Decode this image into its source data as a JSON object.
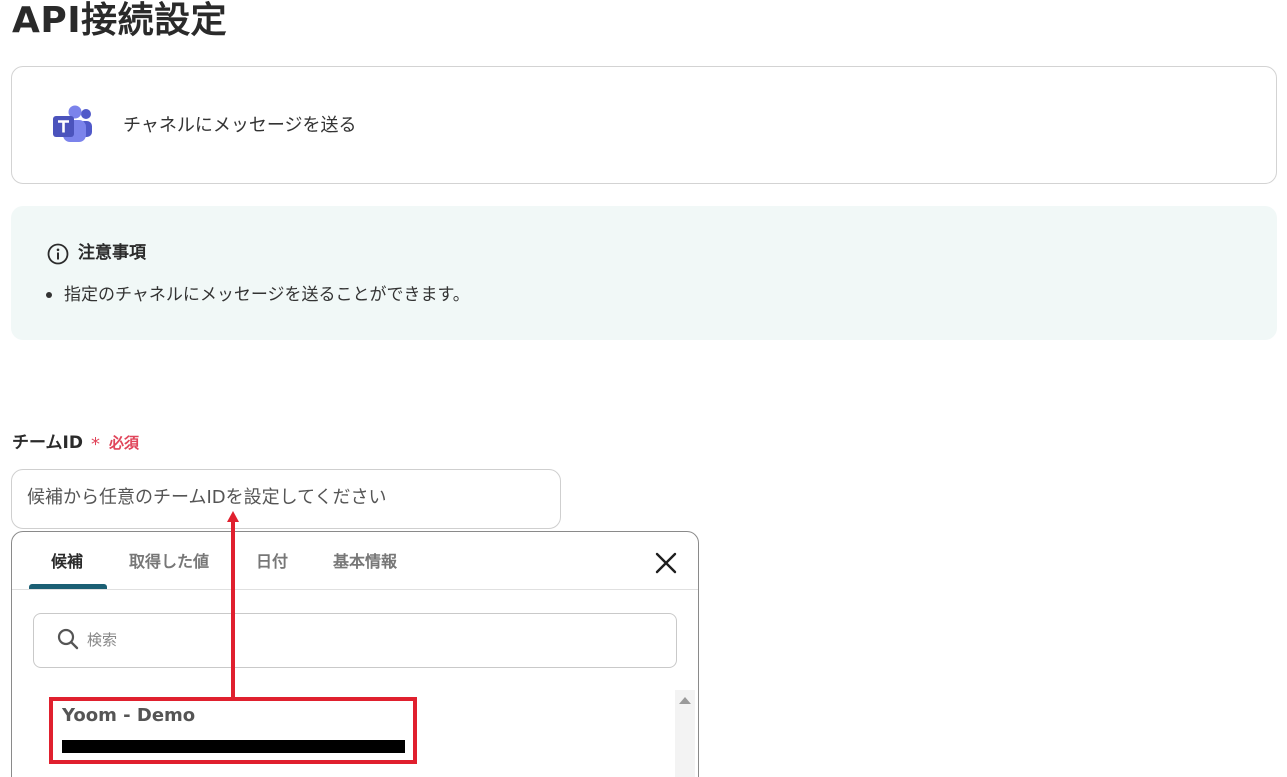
{
  "page": {
    "title": "API接続設定"
  },
  "action": {
    "icon": "microsoft-teams-icon",
    "label": "チャネルにメッセージを送る"
  },
  "notice": {
    "title": "注意事項",
    "items": [
      "指定のチャネルにメッセージを送ることができます。"
    ]
  },
  "field": {
    "label": "チームID",
    "required_star": "*",
    "required_text": "必須",
    "placeholder": "候補から任意のチームIDを設定してください"
  },
  "dropdown": {
    "tabs": [
      {
        "label": "候補",
        "active": true
      },
      {
        "label": "取得した値",
        "active": false
      },
      {
        "label": "日付",
        "active": false
      },
      {
        "label": "基本情報",
        "active": false
      }
    ],
    "search_placeholder": "検索",
    "options": [
      {
        "name": "Yoom - Demo",
        "id_redacted": true
      }
    ]
  },
  "colors": {
    "accent": "#1b5f74",
    "required": "#e0455a",
    "annotation": "#e0202e",
    "notice_bg": "#f1f8f7",
    "teams_purple": "#5059c9"
  }
}
